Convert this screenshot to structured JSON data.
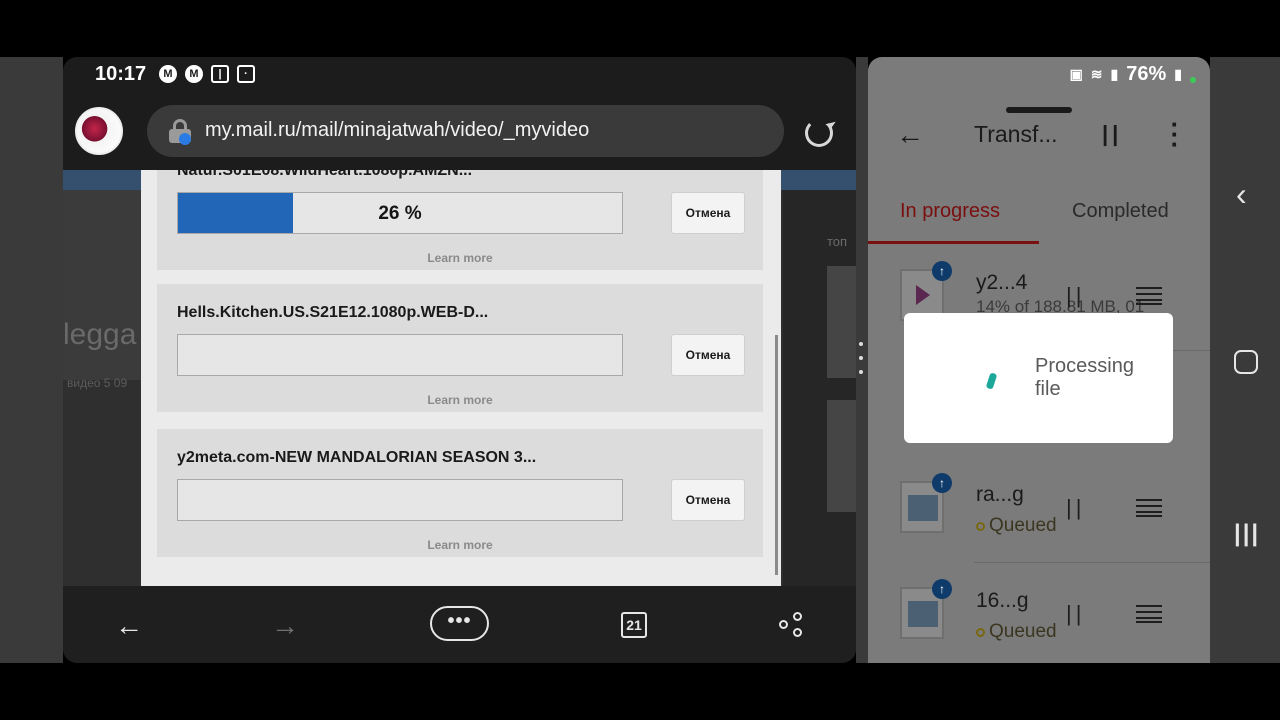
{
  "status": {
    "time": "10:17",
    "icons": [
      "m-icon",
      "m-icon",
      "twitch-icon",
      "screen-icon"
    ]
  },
  "browser": {
    "url": "my.mail.ru/mail/minajatwah/video/_myvideo",
    "bg_ghost_text": "legga",
    "bg_ghost_small": "видео 5 09",
    "bg_ghost_top": "топ",
    "downloads": [
      {
        "title": "Natur.S01E08.WildHeart.1080p.AMZN...",
        "progress_label": "26 %",
        "progress": 0.26,
        "cancel": "Отмена",
        "learn_more": "Learn more"
      },
      {
        "title": "Hells.Kitchen.US.S21E12.1080p.WEB-D...",
        "progress_label": "",
        "progress": 0,
        "cancel": "Отмена",
        "learn_more": "Learn more"
      },
      {
        "title": "y2meta.com-NEW MANDALORIAN SEASON 3...",
        "progress_label": "",
        "progress": 0,
        "cancel": "Отмена",
        "learn_more": "Learn more"
      }
    ],
    "nav": {
      "back": "←",
      "forward": "→",
      "more": "•••",
      "tabs_count": "21"
    }
  },
  "transfers": {
    "battery": "76%",
    "title": "Transf...",
    "tabs": [
      "In progress",
      "Completed"
    ],
    "rows": [
      {
        "name": "y2...4",
        "detail": "14% of 188.81 MB, 01",
        "status": "",
        "kind": "video"
      },
      {
        "name": "ra...g",
        "status": "Queued",
        "kind": "image"
      },
      {
        "name": "16...g",
        "status": "Queued",
        "kind": "image"
      }
    ],
    "popup": {
      "text": "Processing file"
    }
  },
  "colors": {
    "accent_red": "#7a0f0f",
    "progress_blue": "#2166b7",
    "spinner_teal": "#1ba89a"
  }
}
